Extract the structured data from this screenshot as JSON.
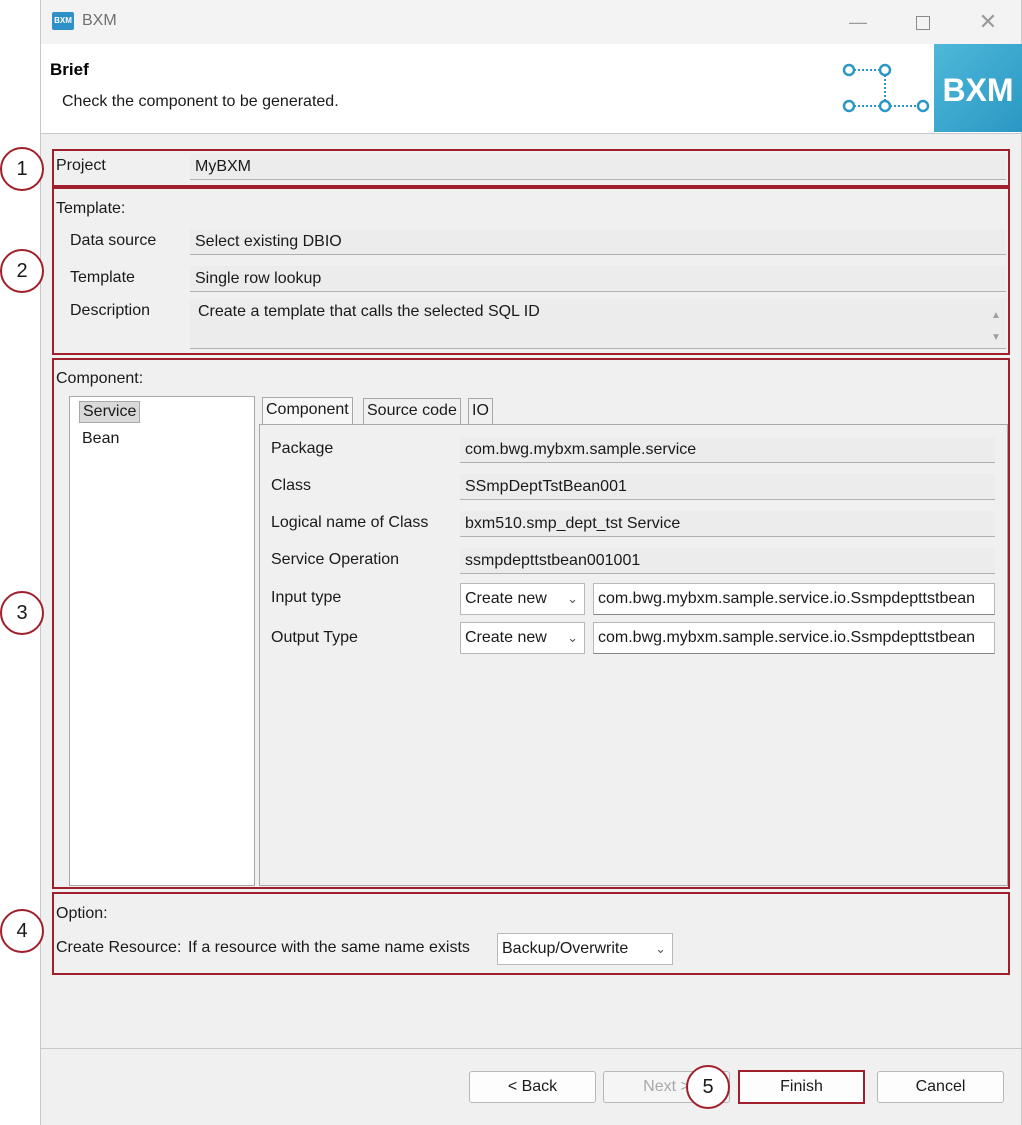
{
  "window": {
    "title": "BXM",
    "app_icon": "BXM"
  },
  "header": {
    "title": "Brief",
    "description": "Check the component to be generated.",
    "logo_text": "BXM",
    "accent": "#2a98c4"
  },
  "markers": [
    "1",
    "2",
    "3",
    "4",
    "5"
  ],
  "project": {
    "label": "Project",
    "value": "MyBXM"
  },
  "template": {
    "section_label": "Template:",
    "data_source_label": "Data source",
    "data_source_value": "Select existing DBIO",
    "template_label": "Template",
    "template_value": "Single row lookup",
    "description_label": "Description",
    "description_value": "Create a template that calls the selected SQL ID"
  },
  "component": {
    "section_label": "Component:",
    "tree": [
      "Service",
      "Bean"
    ],
    "tabs": [
      "Component",
      "Source code",
      "IO"
    ],
    "fields": {
      "package_label": "Package",
      "package_value": "com.bwg.mybxm.sample.service",
      "class_label": "Class",
      "class_value": "SSmpDeptTstBean001",
      "logical_label": "Logical name of Class",
      "logical_value": "bxm510.smp_dept_tst Service",
      "operation_label": "Service Operation",
      "operation_value": "ssmpdepttstbean001001",
      "input_label": "Input type",
      "input_select": "Create new",
      "input_value": "com.bwg.mybxm.sample.service.io.Ssmpdepttstbean",
      "output_label": "Output Type",
      "output_select": "Create new",
      "output_value": "com.bwg.mybxm.sample.service.io.Ssmpdepttstbean"
    }
  },
  "option": {
    "section_label": "Option:",
    "create_label": "Create Resource:",
    "create_desc": "If a resource with the same name exists",
    "create_select": "Backup/Overwrite"
  },
  "buttons": {
    "back": "< Back",
    "next": "Next >",
    "finish": "Finish",
    "cancel": "Cancel"
  },
  "highlight_color": "#9f1f2a"
}
